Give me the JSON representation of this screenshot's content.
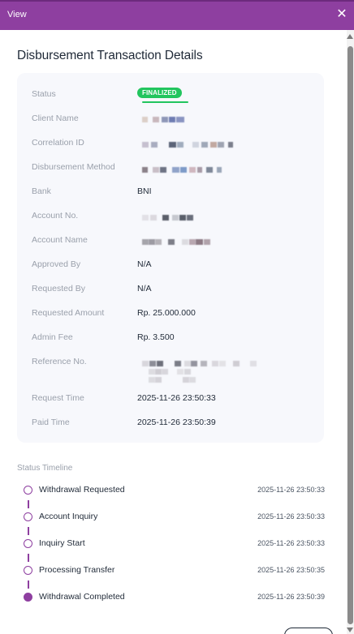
{
  "window": {
    "title": "View",
    "close_symbol": "✕"
  },
  "page": {
    "title": "Disbursement Transaction Details"
  },
  "details": {
    "status": {
      "label": "Status",
      "badge": "FINALIZED"
    },
    "client_name": {
      "label": "Client Name",
      "value": ""
    },
    "correlation_id": {
      "label": "Correlation ID",
      "value": ""
    },
    "disbursement_method": {
      "label": "Disbursement Method",
      "value": ""
    },
    "bank": {
      "label": "Bank",
      "value": "BNI"
    },
    "account_no": {
      "label": "Account No.",
      "value": ""
    },
    "account_name": {
      "label": "Account Name",
      "value": ""
    },
    "approved_by": {
      "label": "Approved By",
      "value": "N/A"
    },
    "requested_by": {
      "label": "Requested By",
      "value": "N/A"
    },
    "requested_amount": {
      "label": "Requested Amount",
      "value": "Rp. 25.000.000"
    },
    "admin_fee": {
      "label": "Admin Fee",
      "value": "Rp. 3.500"
    },
    "reference_no": {
      "label": "Reference No.",
      "value": ""
    },
    "request_time": {
      "label": "Request Time",
      "value": "2025-11-26 23:50:33"
    },
    "paid_time": {
      "label": "Paid Time",
      "value": "2025-11-26 23:50:39"
    }
  },
  "timeline": {
    "title": "Status Timeline",
    "items": [
      {
        "label": "Withdrawal Requested",
        "time": "2025-11-26 23:50:33",
        "completed": false
      },
      {
        "label": "Account Inquiry",
        "time": "2025-11-26 23:50:33",
        "completed": false
      },
      {
        "label": "Inquiry Start",
        "time": "2025-11-26 23:50:33",
        "completed": false
      },
      {
        "label": "Processing Transfer",
        "time": "2025-11-26 23:50:35",
        "completed": false
      },
      {
        "label": "Withdrawal Completed",
        "time": "2025-11-26 23:50:39",
        "completed": true
      }
    ]
  },
  "colors": {
    "accent": "#8e3fa0",
    "status_success": "#22c55e"
  }
}
